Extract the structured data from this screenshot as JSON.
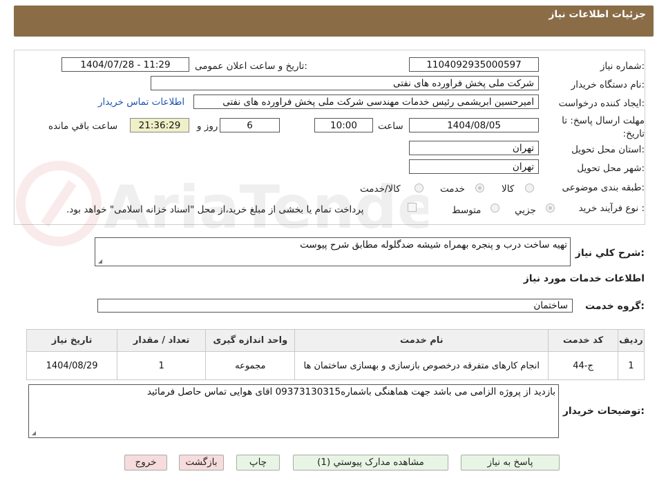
{
  "header": {
    "title": "جزئیات اطلاعات نیاز"
  },
  "form": {
    "need_number_label": "شماره نیاز:",
    "need_number": "1104092935000597",
    "announce_label": "تاریخ و ساعت اعلان عمومی:",
    "announce_value": "1404/07/28 - 11:29",
    "buyer_label": "نام دستگاه خریدار:",
    "buyer_value": "شرکت ملی پخش فراورده های نفتی",
    "creator_label": "ایجاد کننده درخواست:",
    "creator_value": "امیرحسین ابریشمی رئیس خدمات مهندسی شرکت ملی پخش فراورده های نفتی",
    "contact_link": "اطلاعات تماس خریدار",
    "deadline_label": "مهلت ارسال پاسخ: تا تاریخ:",
    "deadline_date": "1404/08/05",
    "time_label": "ساعت",
    "deadline_time": "10:00",
    "days_value": "6",
    "days_label": "روز و",
    "remaining_time": "21:36:29",
    "remaining_label": "ساعت باقي مانده",
    "province_label": "استان محل تحویل:",
    "province_value": "تهران",
    "city_label": "شهر محل تحویل:",
    "city_value": "تهران",
    "category_label": "طبقه بندی موضوعی:",
    "category_options": [
      "کالا",
      "خدمت",
      "کالا/خدمت"
    ],
    "process_label": "نوع فرآیند خرید :",
    "process_options": [
      "جزیي",
      "متوسط"
    ],
    "payment_note": "پرداخت تمام یا بخشی از مبلغ خرید،از محل \"اسناد خزانه اسلامی\" خواهد بود."
  },
  "description": {
    "label": "شرح کلي نياز:",
    "value": "تهیه ساخت درب و پنجره بهمراه شیشه ضدگلوله مطابق شرح پیوست"
  },
  "services": {
    "section_title": "اطلاعات خدمات مورد نياز",
    "group_label": "گروه خدمت:",
    "group_value": "ساختمان",
    "columns": [
      "رديف",
      "کد خدمت",
      "نام خدمت",
      "واحد اندازه گیری",
      "تعداد / مقدار",
      "تاریخ نیاز"
    ],
    "rows": [
      {
        "index": "1",
        "code": "ج-44",
        "name": "انجام کارهای متفرقه درخصوص بازسازی و بهسازی ساختمان ها",
        "unit": "مجموعه",
        "qty": "1",
        "date": "1404/08/29"
      }
    ]
  },
  "buyer_notes": {
    "label": "توضيحات خريدار:",
    "value": "بازدید از پروژه الزامی می باشد جهت هماهنگی باشماره09373130315 اقای هوایی تماس حاصل فرمائید"
  },
  "buttons": {
    "reply": "پاسخ به نیاز",
    "attachments": "مشاهده مدارک پیوستي (1)",
    "print": "چاپ",
    "back": "بازگشت",
    "exit": "خروج"
  },
  "watermark_text": "AriaTender.neT",
  "colors": {
    "header_bg": "#8a6d47",
    "link": "#1a55b0",
    "timer_bg": "#f0f0c8",
    "btn_green": "#e8f5e4",
    "btn_red": "#f6dcdc"
  }
}
